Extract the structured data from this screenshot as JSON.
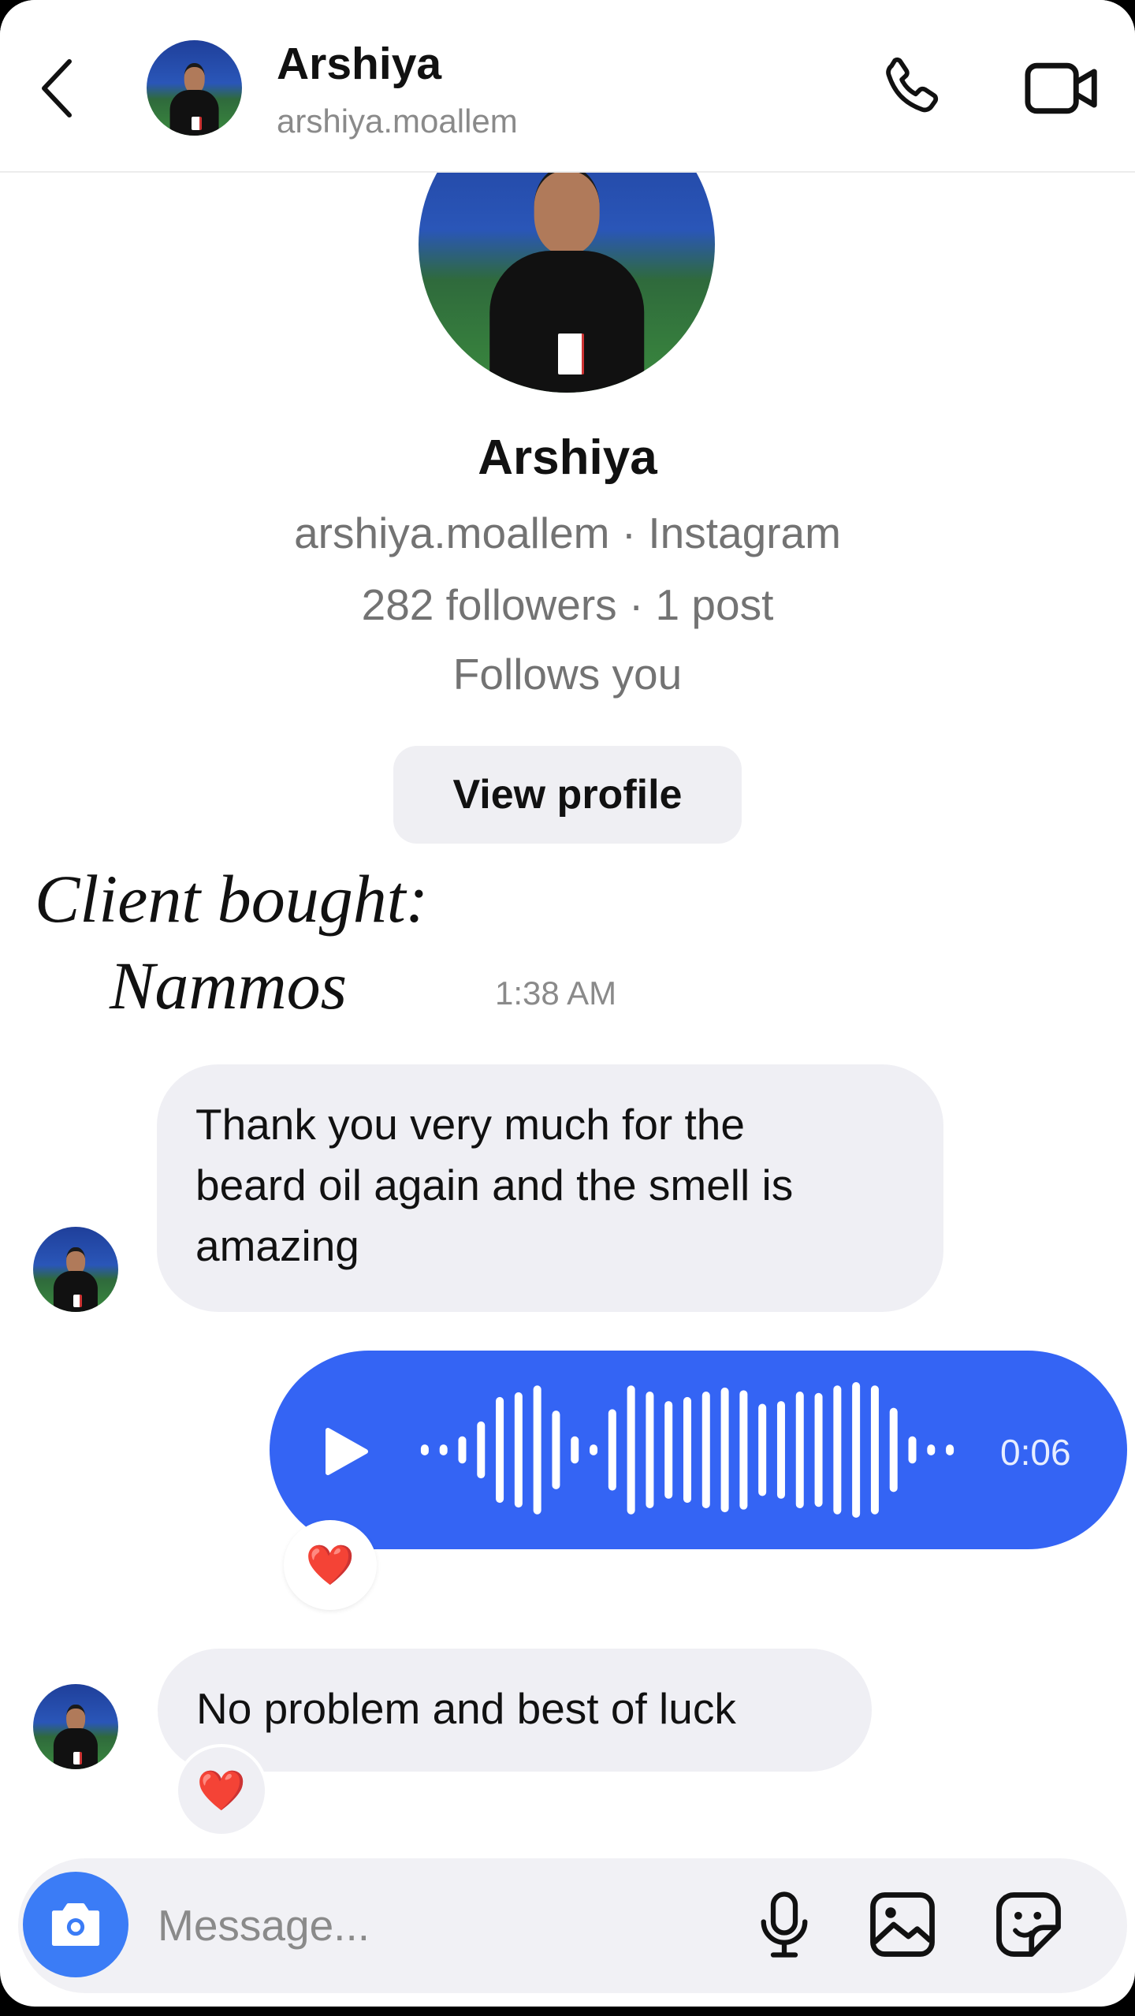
{
  "header": {
    "title": "Arshiya",
    "subtitle": "arshiya.moallem",
    "icons": [
      "back-chevron-icon",
      "avatar",
      "phone-icon",
      "video-camera-icon"
    ]
  },
  "profile": {
    "name": "Arshiya",
    "handle_line": "arshiya.moallem · Instagram",
    "stats_line": "282 followers · 1 post",
    "follow_status": "Follows you",
    "view_profile_label": "View profile"
  },
  "overlay_note": {
    "line1": "Client bought:",
    "line2": "Nammos"
  },
  "messages": {
    "timestamp": "1:38 AM",
    "incoming_1": {
      "lines": [
        "Thank you very much for the",
        "beard oil again and the smell is",
        "amazing"
      ]
    },
    "voice": {
      "duration": "0:06",
      "waveform_levels": [
        0.08,
        0.08,
        0.2,
        0.42,
        0.78,
        0.85,
        0.95,
        0.58,
        0.2,
        0.08,
        0.6,
        0.95,
        0.86,
        0.72,
        0.78,
        0.86,
        0.92,
        0.88,
        0.68,
        0.72,
        0.86,
        0.84,
        0.95,
        1.0,
        0.95,
        0.62,
        0.2,
        0.08,
        0.08
      ],
      "reaction": "❤️"
    },
    "incoming_2": {
      "text": "No problem and best of luck",
      "reaction": "❤️"
    }
  },
  "composer": {
    "placeholder": "Message...",
    "icons": [
      "camera-icon",
      "microphone-icon",
      "gallery-icon",
      "sticker-icon"
    ]
  },
  "colors": {
    "accent_blue": "#3464f4",
    "camera_blue": "#3b7cf6",
    "incoming_bubble": "#efeff4"
  }
}
